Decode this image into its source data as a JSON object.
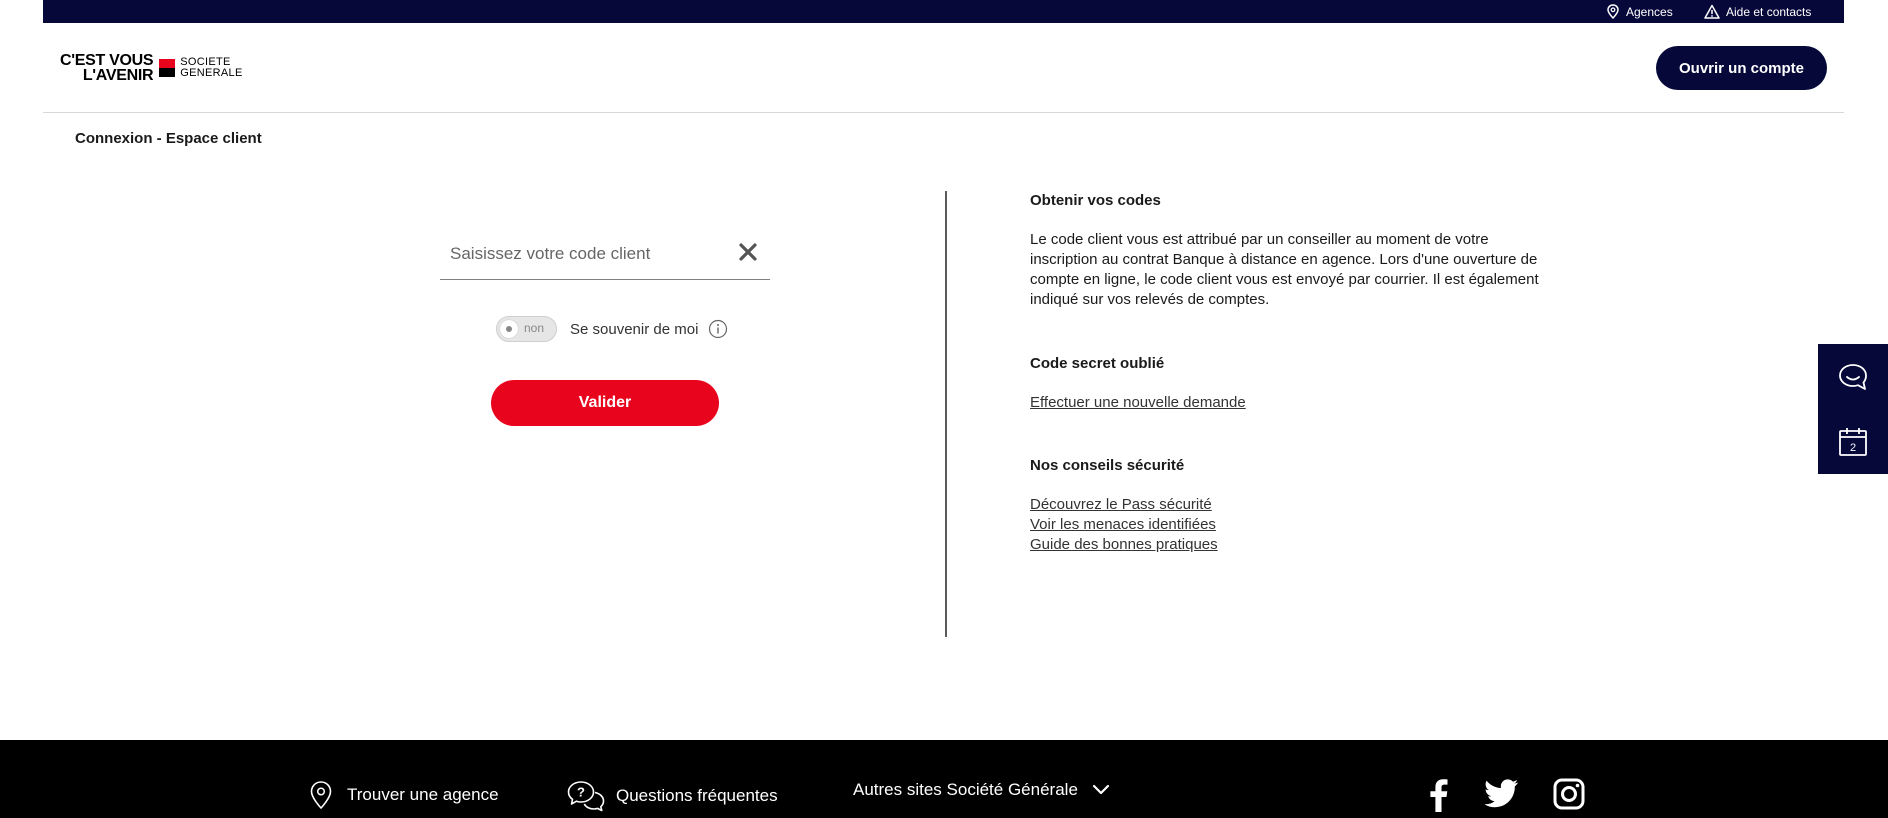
{
  "topbar": {
    "agences": "Agences",
    "aide": "Aide et contacts"
  },
  "header": {
    "logo_line1": "C'EST VOUS",
    "logo_line2": "L'AVENIR",
    "brand_line1": "SOCIETE",
    "brand_line2": "GENERALE",
    "open_account_label": "Ouvrir un compte"
  },
  "breadcrumb": "Connexion - Espace client",
  "login": {
    "client_code_placeholder": "Saisissez votre code client",
    "client_code_value": "",
    "toggle_state": "non",
    "remember_label": "Se souvenir de moi",
    "submit_label": "Valider"
  },
  "info": {
    "codes_title": "Obtenir vos codes",
    "codes_text": "Le code client vous est attribué par un conseiller au moment de votre inscription au contrat Banque à distance en agence. Lors d'une ouverture de compte en ligne, le code client vous est envoyé par courrier. Il est également indiqué sur vos relevés de comptes.",
    "secret_title": "Code secret oublié",
    "secret_link": "Effectuer une nouvelle demande",
    "security_title": "Nos conseils sécurité",
    "security_links": [
      "Découvrez le Pass sécurité",
      "Voir les menaces identifiées",
      "Guide des bonnes pratiques"
    ]
  },
  "side_widget": {
    "calendar_day": "2"
  },
  "footer": {
    "agence": "Trouver une agence",
    "faq": "Questions fréquentes",
    "sites": "Autres sites Société Générale"
  },
  "colors": {
    "navy": "#06083a",
    "red": "#e9041e",
    "footer_bg": "#000000"
  }
}
